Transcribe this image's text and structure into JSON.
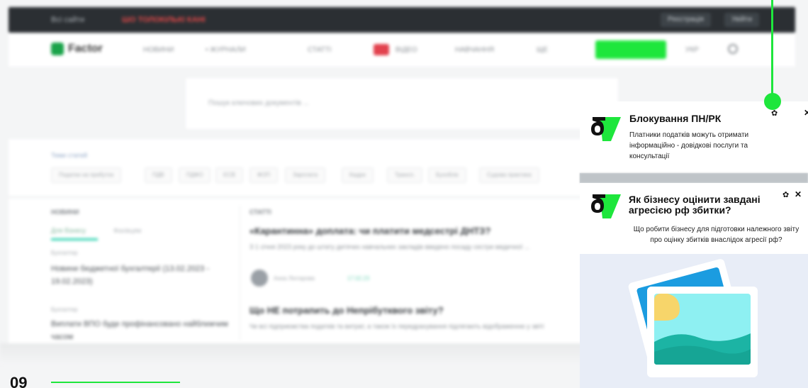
{
  "background_site": {
    "topbar": {
      "left_text": "Всі сайти",
      "alert_text": "ШО ТОЛОКІЛЬКІ КАНІ",
      "pill_1": "Реєстрація",
      "pill_2": "Увійти"
    },
    "nav": {
      "logo": "Factor",
      "items": [
        "НОВИНИ",
        "• ЖУРНАЛИ",
        "СТАТТІ",
        "ВІДЕО",
        "НАВЧАННЯ",
        "ЩЕ"
      ],
      "extra": "УКР"
    },
    "search_placeholder": "Пошук ключових документів ...",
    "tags_label": "Теми статей",
    "tags": [
      "Податки на прибуток",
      "ПДВ",
      "ПДФО",
      "ЄСВ",
      "ФОП",
      "Зарплата",
      "Кадри",
      "Трансп.",
      "Бухоблік",
      "Судова практика"
    ],
    "news": {
      "heading": "НОВИНИ",
      "tab_1": "Для бізнесу",
      "tab_2": "Фахівцям",
      "items": [
        {
          "source": "Бухгалтер",
          "title": "Новини бюджетної бухгалтерії (13.02.2023 - 19.02.2023)"
        },
        {
          "source": "Бухгалтер",
          "title": "Виплати ВПО буде профінансовано найближчим часом"
        }
      ]
    },
    "articles": {
      "heading": "СТАТТІ",
      "items": [
        {
          "title": "«Карантинна» доплата: чи платити медсестрі ДНТЗ?",
          "text": "З 1 січня 2023 року до штату дитячих навчальних закладів введено посаду сестри медичної ..."
        },
        {
          "title": "Що НЕ потрапить до Непрібутквого звіту?",
          "text": "Чи всі підприємства податків та витрат, а також їх передрахування підлягають відображенню у звіті"
        }
      ],
      "author": "Анна Лінтарова",
      "date": "17.02.23"
    }
  },
  "slide": {
    "number": "09"
  },
  "notifications": [
    {
      "title": "Блокування ПН/РК",
      "body": "Платники податків можуть отримати інформаційно - довідкові послуги та консультації"
    },
    {
      "title": "Як бізнесу оцінити завдані агресією рф збитки?",
      "body": "Що робити бізнесу для підготовки належного звіту про оцінку збитків внаслідок агресії рф?"
    }
  ],
  "icons": {
    "logo": "factor-logo-icon",
    "settings": "gear-icon",
    "close": "close-icon",
    "image": "image-placeholder-icon"
  },
  "colors": {
    "accent": "#1ee63c",
    "dark": "#111111"
  }
}
